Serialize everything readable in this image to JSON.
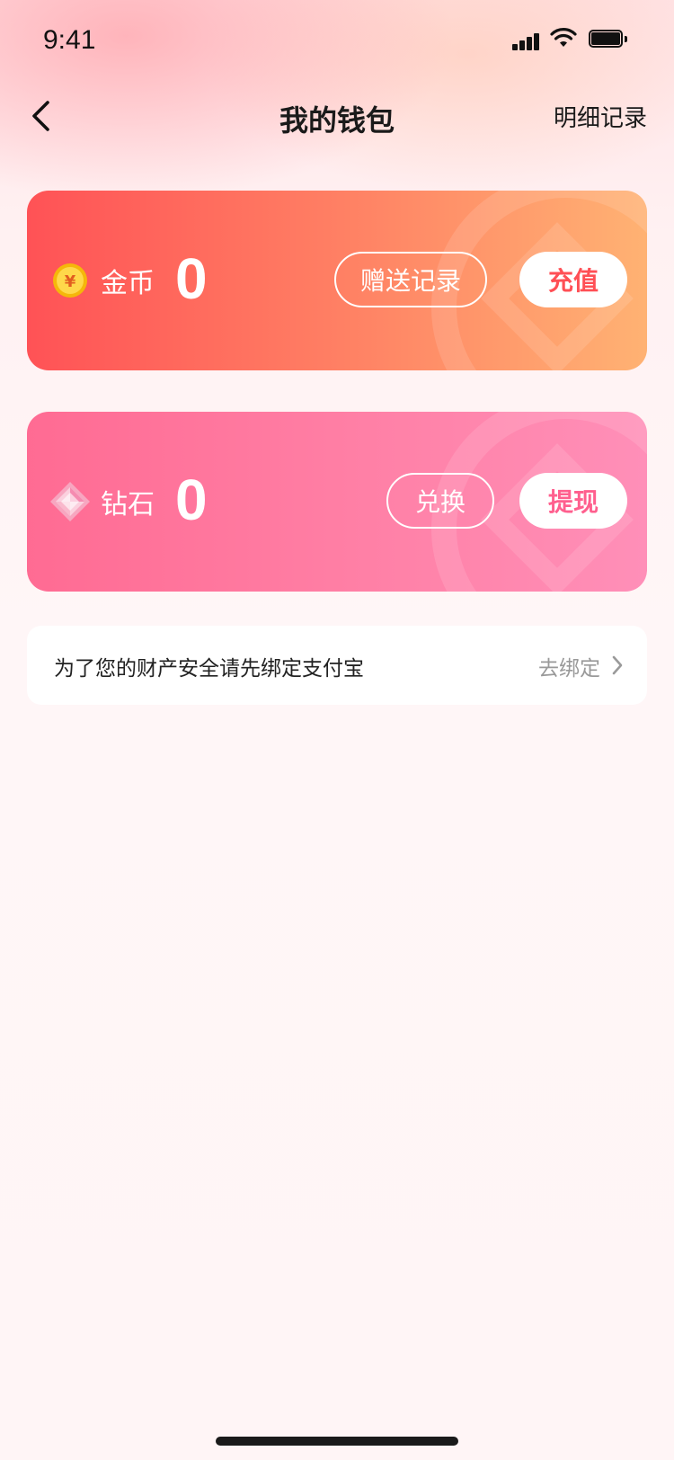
{
  "status_bar": {
    "time": "9:41"
  },
  "nav": {
    "title": "我的钱包",
    "right_link": "明细记录",
    "back_icon": "chevron-left-icon"
  },
  "coin_card": {
    "icon": "gold-coin-icon",
    "label": "金币",
    "value": "0",
    "secondary_button": "赠送记录",
    "primary_button": "充值",
    "gradient": [
      "#ff5256",
      "#ff8465",
      "#ffb273"
    ],
    "button_text_color": "#ff4f55"
  },
  "diamond_card": {
    "icon": "diamond-icon",
    "label": "钻石",
    "value": "0",
    "secondary_button": "兑换",
    "primary_button": "提现",
    "gradient": [
      "#ff6b93",
      "#ff80a6",
      "#ff8fb8"
    ],
    "button_text_color": "#ff5f8e"
  },
  "bind_alipay": {
    "text": "为了您的财产安全请先绑定支付宝",
    "action": "去绑定",
    "action_icon": "chevron-right-icon"
  }
}
